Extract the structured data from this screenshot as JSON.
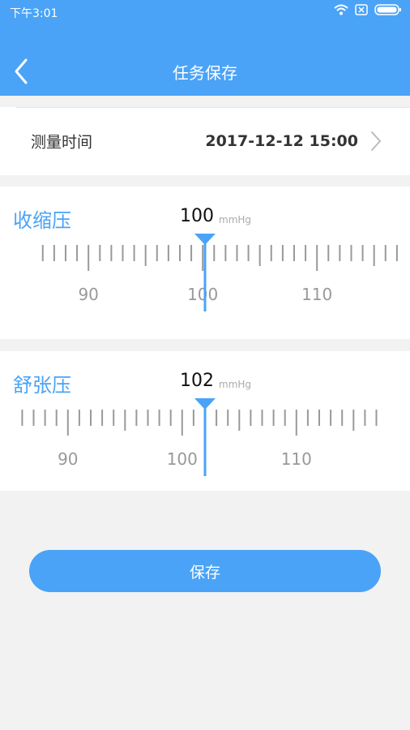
{
  "status_bar": {
    "time": "下午3:01",
    "icons": [
      "wifi-icon",
      "sim-none-icon",
      "battery-icon"
    ]
  },
  "nav": {
    "title": "任务保存",
    "back_icon": "chevron-left-icon"
  },
  "measure_time": {
    "label": "测量时间",
    "value": "2017-12-12 15:00"
  },
  "systolic": {
    "label": "收缩压",
    "value": "100",
    "unit": "mmHg",
    "ruler": {
      "min": 86,
      "max": 117,
      "selected": 100.2,
      "major_step": 10,
      "labels": [
        "90",
        "100",
        "110"
      ]
    }
  },
  "diastolic": {
    "label": "舒张压",
    "value": "102",
    "unit": "mmHg",
    "ruler": {
      "min": 86,
      "max": 117,
      "selected": 102,
      "major_step": 10,
      "labels": [
        "90",
        "100",
        "110"
      ]
    }
  },
  "save_button": {
    "label": "保存"
  },
  "colors": {
    "accent": "#4aa3f7",
    "background": "#f2f2f2",
    "tick": "#999999"
  }
}
